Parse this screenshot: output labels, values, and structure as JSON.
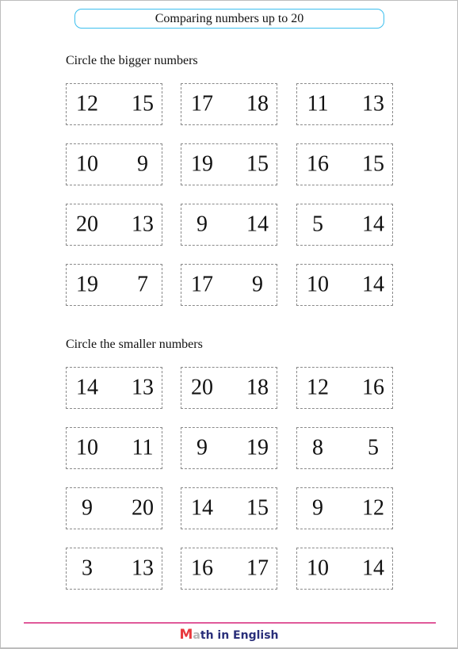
{
  "title": "Comparing numbers up to 20",
  "sections": [
    {
      "label": "Circle the bigger numbers",
      "pairs": [
        [
          "12",
          "15"
        ],
        [
          "17",
          "18"
        ],
        [
          "11",
          "13"
        ],
        [
          "10",
          "9"
        ],
        [
          "19",
          "15"
        ],
        [
          "16",
          "15"
        ],
        [
          "20",
          "13"
        ],
        [
          "9",
          "14"
        ],
        [
          "5",
          "14"
        ],
        [
          "19",
          "7"
        ],
        [
          "17",
          "9"
        ],
        [
          "10",
          "14"
        ]
      ]
    },
    {
      "label": "Circle the smaller numbers",
      "pairs": [
        [
          "14",
          "13"
        ],
        [
          "20",
          "18"
        ],
        [
          "12",
          "16"
        ],
        [
          "10",
          "11"
        ],
        [
          "9",
          "19"
        ],
        [
          "8",
          "5"
        ],
        [
          "9",
          "20"
        ],
        [
          "14",
          "15"
        ],
        [
          "9",
          "12"
        ],
        [
          "3",
          "13"
        ],
        [
          "16",
          "17"
        ],
        [
          "10",
          "14"
        ]
      ]
    }
  ],
  "footer": {
    "brand_m": "M",
    "brand_a": "a",
    "brand_rest": "th in English"
  },
  "colors": {
    "title_border": "#3cbfee",
    "footer_line": "#e05a9a",
    "brand_m": "#e8383d",
    "brand_text": "#2a2f7a"
  }
}
